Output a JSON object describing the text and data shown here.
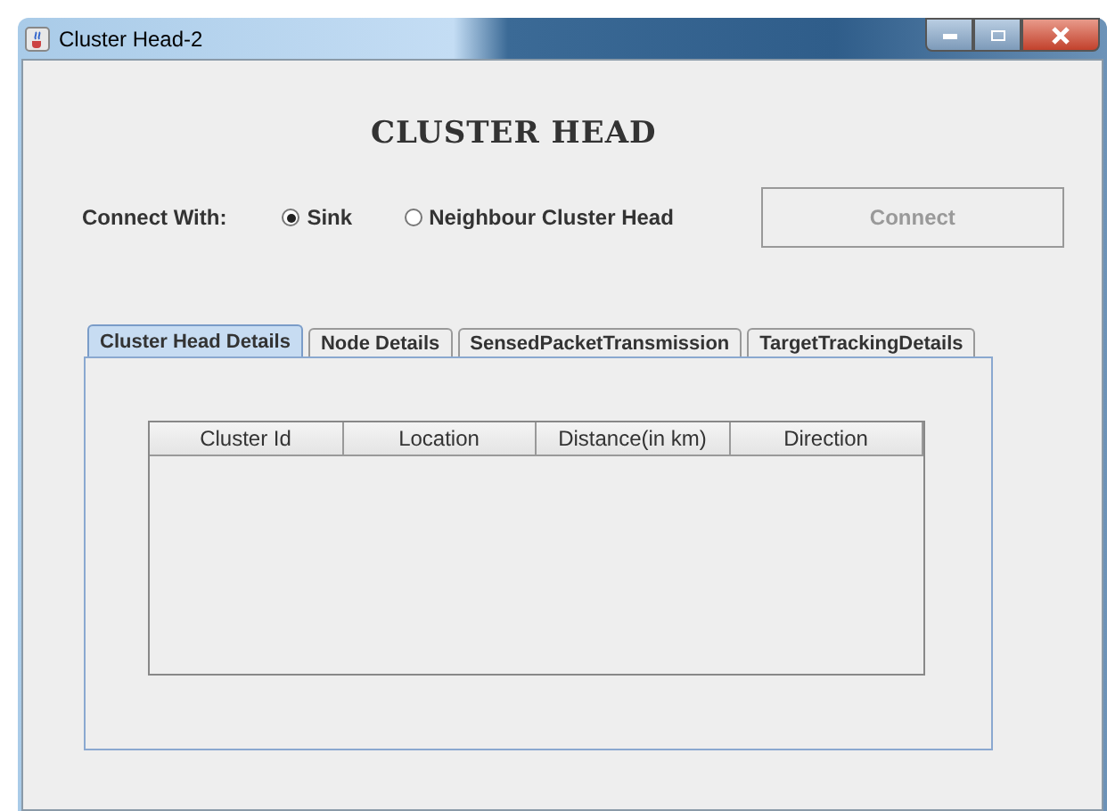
{
  "window": {
    "title": "Cluster Head-2"
  },
  "heading": "CLUSTER HEAD",
  "connect_with": {
    "label": "Connect With:",
    "options": [
      {
        "label": "Sink",
        "selected": true
      },
      {
        "label": "Neighbour Cluster Head",
        "selected": false
      }
    ]
  },
  "connect_button": {
    "label": "Connect",
    "disabled": true
  },
  "tabs": [
    {
      "label": "Cluster Head Details",
      "selected": true
    },
    {
      "label": "Node Details",
      "selected": false
    },
    {
      "label": "SensedPacketTransmission",
      "selected": false
    },
    {
      "label": "TargetTrackingDetails",
      "selected": false
    }
  ],
  "table": {
    "columns": [
      "Cluster Id",
      "Location",
      "Distance(in km)",
      "Direction"
    ]
  }
}
